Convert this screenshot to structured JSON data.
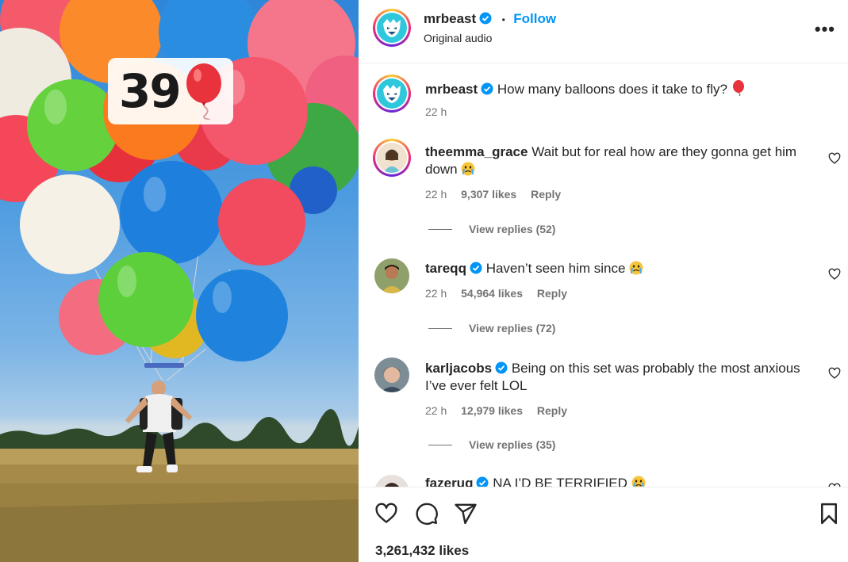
{
  "media": {
    "counter_value": "39",
    "counter_icon": "red-balloon-emoji"
  },
  "header": {
    "username": "mrbeast",
    "separator": "•",
    "follow_label": "Follow",
    "audio_label": "Original audio",
    "more_icon": "more-horizontal-icon"
  },
  "caption": {
    "username": "mrbeast",
    "text": "How many balloons does it take to fly?",
    "emoji": "balloon-emoji",
    "time": "22 h"
  },
  "comments": [
    {
      "username": "theemma_grace",
      "verified": false,
      "text": "Wait but for real how are they gonna get him down",
      "emoji": "crying-face-emoji",
      "time": "22 h",
      "likes": "9,307 likes",
      "reply_label": "Reply",
      "view_replies": "View replies (52)"
    },
    {
      "username": "tareqq",
      "verified": true,
      "text": "Haven’t seen him since",
      "emoji": "crying-face-emoji",
      "time": "22 h",
      "likes": "54,964 likes",
      "reply_label": "Reply",
      "view_replies": "View replies (72)"
    },
    {
      "username": "karljacobs",
      "verified": true,
      "text": "Being on this set was probably the most anxious I’ve ever felt LOL",
      "time": "22 h",
      "likes": "12,979 likes",
      "reply_label": "Reply",
      "view_replies": "View replies (35)"
    },
    {
      "username": "fazerug",
      "verified": true,
      "text": "NA I’D BE TERRIFIED",
      "emoji": "crying-face-emoji"
    }
  ],
  "footer": {
    "likes_count": "3,261,432 likes",
    "like_icon": "heart-icon",
    "comment_icon": "comment-icon",
    "share_icon": "share-icon",
    "save_icon": "bookmark-icon"
  },
  "colors": {
    "accent": "#0095f6",
    "verified": "#0095f6",
    "text": "#262626",
    "muted": "#737373"
  }
}
